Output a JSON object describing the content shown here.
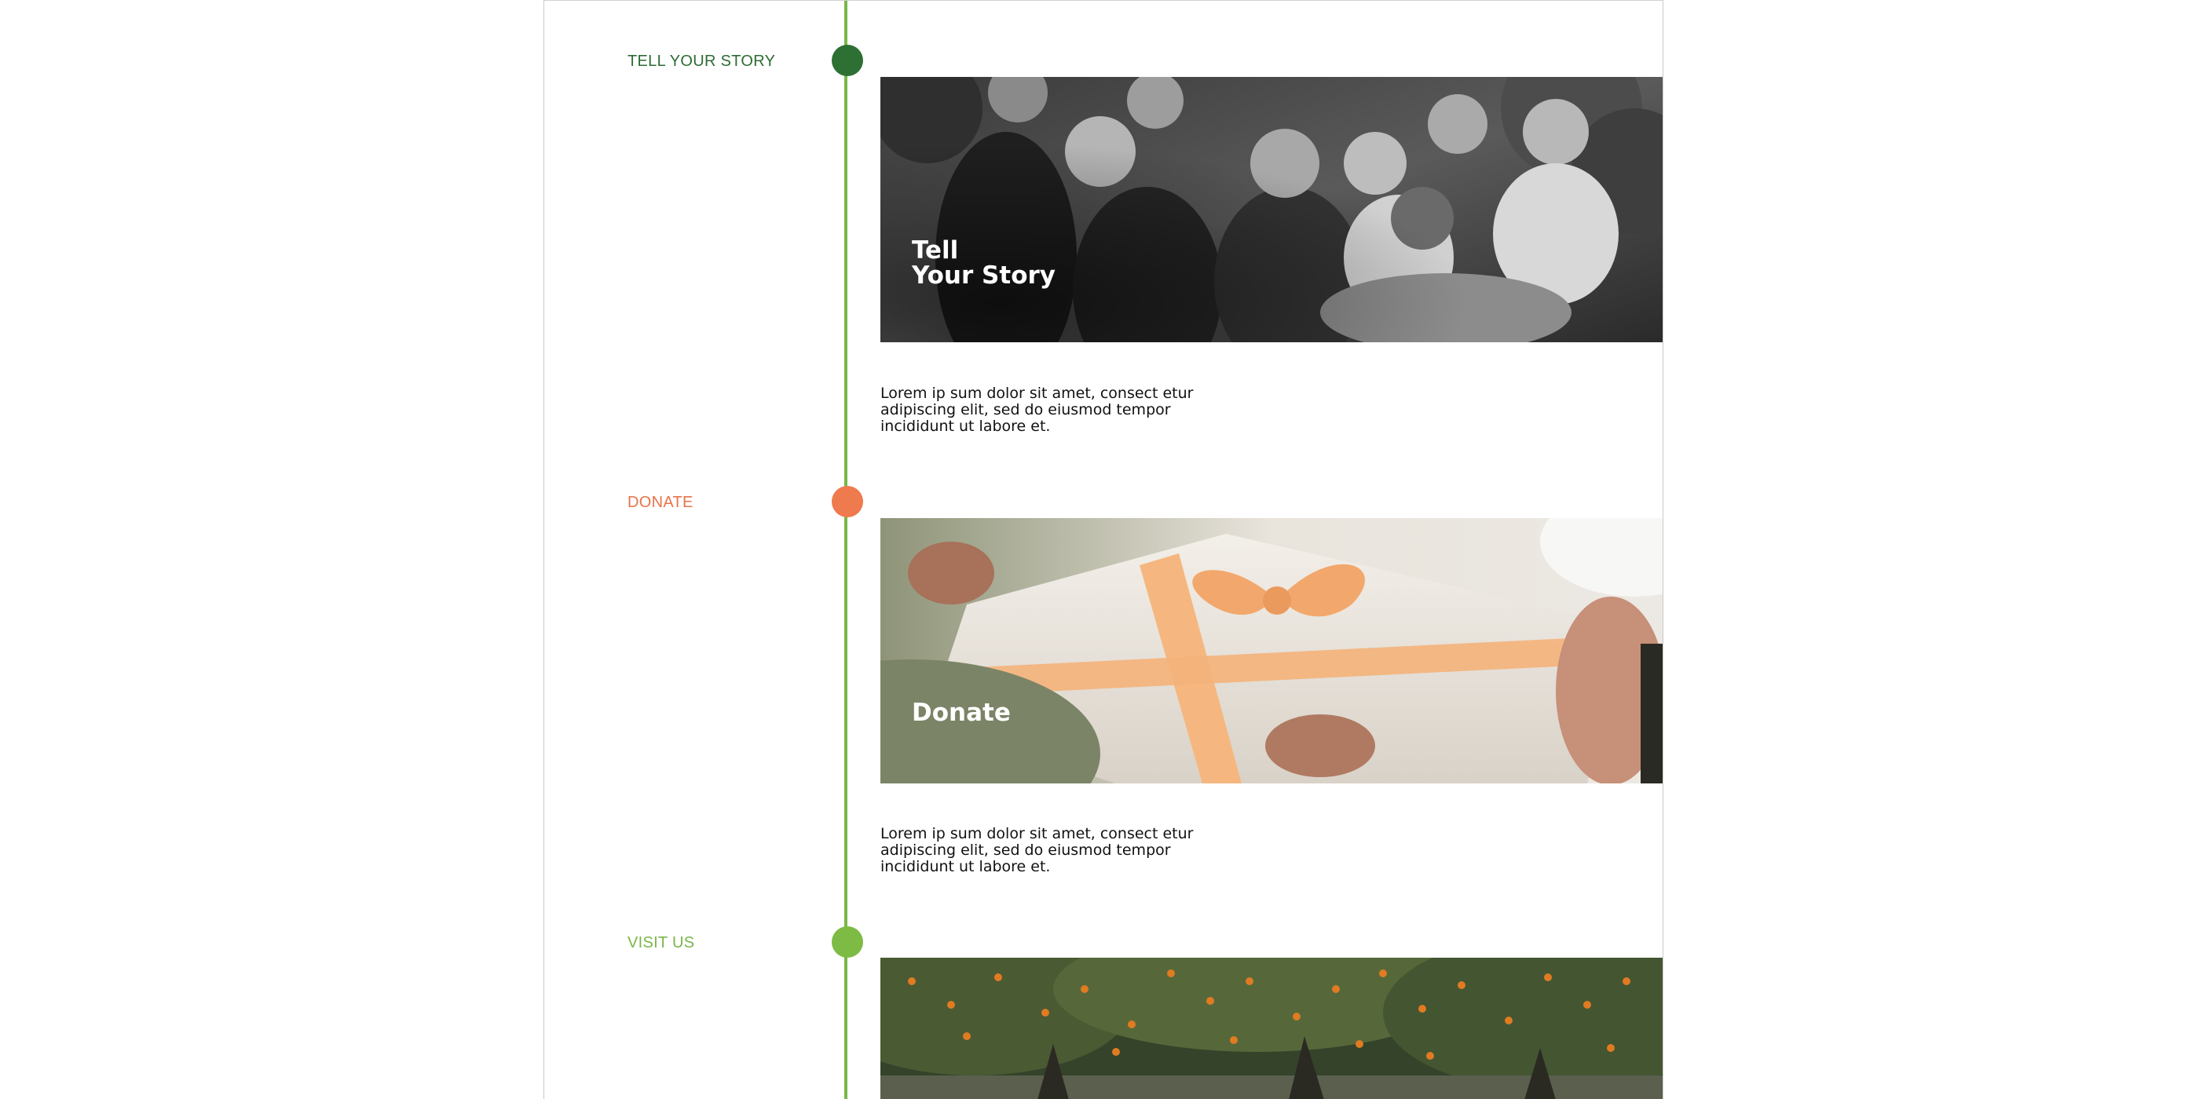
{
  "timeline": {
    "line_color": "#7ab648",
    "sections": [
      {
        "label": "TELL YOUR STORY",
        "label_color": "#2e6b35",
        "node_color": "#2e7034",
        "banner_title": "Tell\nYour Story",
        "body": "Lorem ip sum dolor sit amet, consect etur adipiscing elit, sed do eiusmod tempor incididunt ut labore et."
      },
      {
        "label": "DONATE",
        "label_color": "#e8734a",
        "node_color": "#ee7a4e",
        "banner_title": "Donate",
        "body": "Lorem ip sum dolor sit amet, consect etur adipiscing elit, sed do eiusmod tempor incididunt ut labore et."
      },
      {
        "label": "VISIT US",
        "label_color": "#7ab648",
        "node_color": "#7dbb44",
        "banner_title": "",
        "body": ""
      }
    ]
  }
}
